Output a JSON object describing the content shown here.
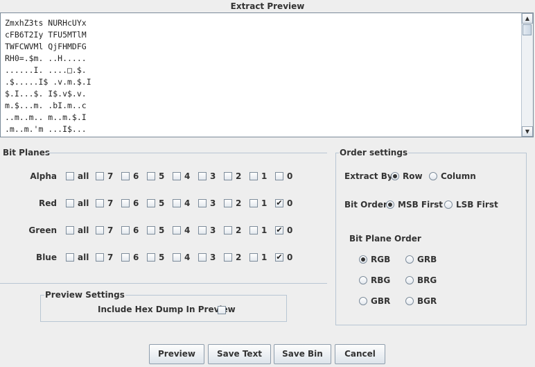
{
  "title": "Extract Preview",
  "preview_text": "ZmxhZ3ts NURHcUYx\ncFB6T2Iy TFU5MTlM\nTWFCWVMl QjFHMDFG\nRH0=.$m. ..H.....\n......I. ....□.$.\n.$.....I$ .v.m.$.I\n$.I...$. I$.v$.v.\nm.$...m. .bI.m..c\n..m..m.. m..m.$.I\n.m..m.'m ...I$...\n....:...",
  "bit_planes": {
    "label": "Bit Planes",
    "bit_labels": [
      "all",
      "7",
      "6",
      "5",
      "4",
      "3",
      "2",
      "1",
      "0"
    ],
    "rows": [
      {
        "name": "Alpha",
        "checked": [
          false,
          false,
          false,
          false,
          false,
          false,
          false,
          false,
          false
        ]
      },
      {
        "name": "Red",
        "checked": [
          false,
          false,
          false,
          false,
          false,
          false,
          false,
          false,
          true
        ]
      },
      {
        "name": "Green",
        "checked": [
          false,
          false,
          false,
          false,
          false,
          false,
          false,
          false,
          true
        ]
      },
      {
        "name": "Blue",
        "checked": [
          false,
          false,
          false,
          false,
          false,
          false,
          false,
          false,
          true
        ]
      }
    ],
    "check_glyph": "✔"
  },
  "order": {
    "label": "Order settings",
    "extract_by": {
      "label": "Extract By",
      "options": [
        "Row",
        "Column"
      ],
      "selected": 0
    },
    "bit_order": {
      "label": "Bit Order",
      "options": [
        "MSB First",
        "LSB First"
      ],
      "selected": 0
    },
    "plane_order": {
      "label": "Bit Plane Order",
      "options": [
        "RGB",
        "GRB",
        "RBG",
        "BRG",
        "GBR",
        "BGR"
      ],
      "selected": 0
    }
  },
  "preview_settings": {
    "label": "Preview Settings",
    "hexdump_label": "Include Hex Dump In Preview",
    "hexdump_checked": false
  },
  "buttons": {
    "preview": "Preview",
    "save_text": "Save Text",
    "save_bin": "Save Bin",
    "cancel": "Cancel"
  },
  "scroll_icons": {
    "up": "▲",
    "down": "▼"
  }
}
